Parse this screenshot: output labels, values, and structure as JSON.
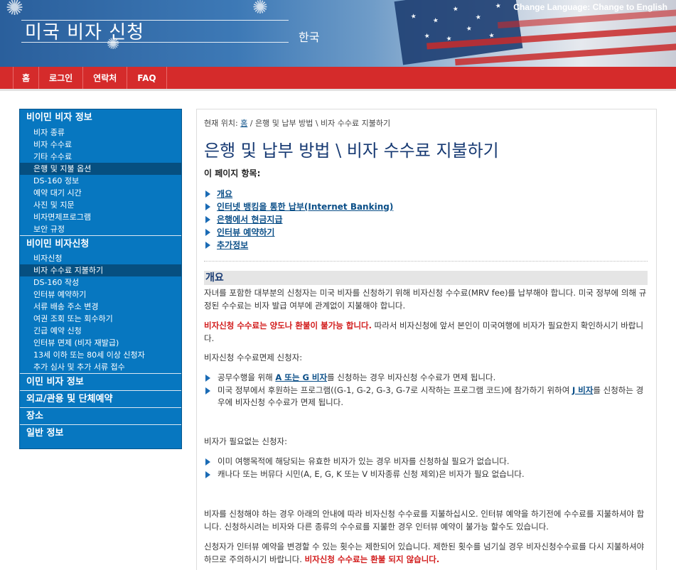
{
  "header": {
    "site_title": "미국 비자 신청",
    "language_name": "한국",
    "change_language_label": "Change Language:",
    "change_language_link": "Change to English"
  },
  "nav": {
    "items": [
      "홈",
      "로그인",
      "연락처",
      "FAQ"
    ]
  },
  "sidebar": {
    "sections": [
      {
        "title": "비이민 비자 정보",
        "items": [
          "비자 종류",
          "비자 수수료",
          "기타 수수료",
          "은행 및 지불 옵션",
          "DS-160 정보",
          "예약 대기 시간",
          "사진 및 지문",
          "비자면제프로그램",
          "보안 규정"
        ]
      },
      {
        "title": "비이민 비자신청",
        "items": [
          "비자신청",
          "비자 수수료 지불하기",
          "DS-160 작성",
          "인터뷰 예약하기",
          "서류 배송 주소 변경",
          "여권 조회 또는 회수하기",
          "긴급 예약 신청",
          "인터뷰 면제 (비자 재발급)",
          "13세 이하 또는 80세 이상 신청자",
          "추가 심사 및 추가 서류 접수"
        ]
      }
    ],
    "collapsed_sections": [
      "이민 비자 정보",
      "외교/관용 및 단체예약",
      "장소",
      "일반 정보"
    ],
    "active_items": [
      "은행 및 지불 옵션",
      "비자 수수료 지불하기"
    ]
  },
  "breadcrumb": {
    "prefix": "현재 위치: ",
    "home_link": "홈",
    "rest": " / 은행 및 납부 방법 \\ 비자 수수료 지불하기"
  },
  "page": {
    "title": "은행 및 납부 방법 \\ 비자 수수료 지불하기",
    "toc_heading": "이 페이지 항목:",
    "toc_items": [
      "개요",
      "인터넷 뱅킹을 통한 납부(Internet Banking)",
      "은행에서 현금지급",
      "인터뷰 예약하기",
      "추가정보"
    ],
    "section_title": "개요",
    "intro": "자녀를 포함한 대부분의 신청자는 미국 비자를 신청하기 위해 비자신청 수수료(MRV fee)를 납부해야 합니다. 미국 정부에 의해 규정된 수수료는 비자 발급 여부에 관계없이 지불해야 합니다.",
    "warning_red": "비자신청 수수료는 양도나 환불이 불가능 합니다.",
    "warning_rest": " 따라서 비자신청에 앞서 본인이 미국여행에 비자가 필요한지 확인하시기 바랍니다.",
    "exempt_heading": "비자신청 수수료면제 신청자:",
    "exempt_1_pre": "공무수행을 위해 ",
    "exempt_1_link": "A 또는 G 비자",
    "exempt_1_post": "를 신청하는 경우 비자신청 수수료가 면제 됩니다.",
    "exempt_2_pre": "미국 정부에서 후원하는 프로그램((G-1, G-2, G-3, G-7로 시작하는 프로그램 코드)에 참가하기 위하여 ",
    "exempt_2_link": "J 비자",
    "exempt_2_post": "를 신청하는 경우에 비자신청 수수료가 면제 됩니다.",
    "no_visa_heading": "비자가 필요없는 신청자:",
    "no_visa_1": "이미 여행목적에 해당되는 유효한 비자가 있는 경우 비자를 신청하실 필요가 없습니다.",
    "no_visa_2": "캐나다 또는 버뮤다 시민(A, E, G, K 또는 V 비자종류 신청 제외)은 비자가 필요 없습니다.",
    "para_fee": "비자를 신청해야 하는 경우 아래의 안내에 따라 비자신청 수수료를 지불하십시오. 인터뷰 예약을 하기전에 수수료를 지불하셔야 합니다. 신청하시려는 비자와 다른 종류의 수수료를 지불한 경우 인터뷰 예약이 불가능 할수도 있습니다.",
    "para_change": "신청자가 인터뷰 예약을 변경할 수 있는 횟수는 제한되어 있습니다. 제한된 횟수를 넘기실 경우 비자신청수수료를 다시 지불하셔야 하므로 주의하시기 바랍니다. ",
    "para_change_red": "비자신청 수수료는 환불 되지 않습니다."
  },
  "colors": {
    "nav_red": "#d52b2b",
    "sidebar_blue": "#0777c0",
    "sidebar_active": "#064f80",
    "link_blue": "#0b4f88",
    "title_navy": "#173a73",
    "warning_red": "#d21c1c"
  }
}
